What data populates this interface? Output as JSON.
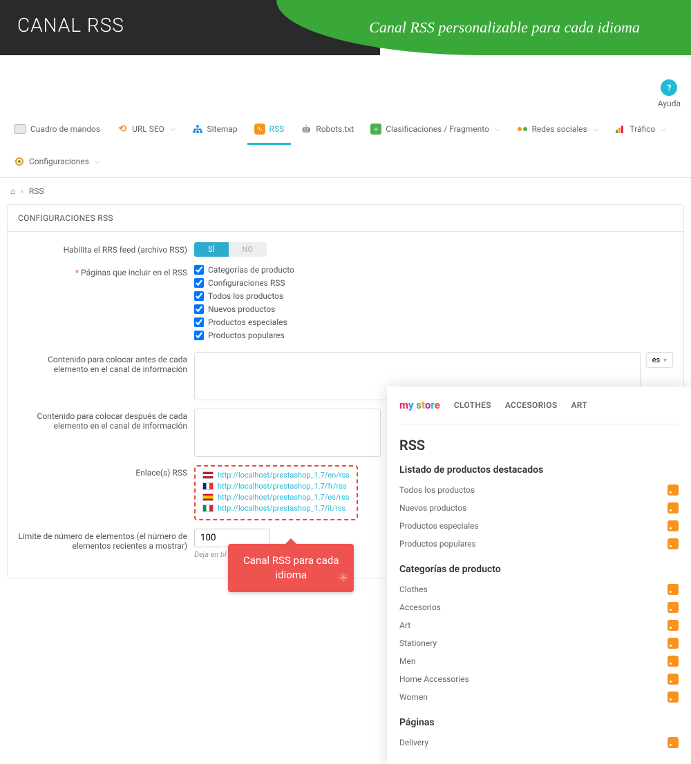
{
  "banner": {
    "title": "CANAL RSS",
    "subtitle": "Canal RSS personalizable para cada idioma"
  },
  "help": {
    "label": "Ayuda"
  },
  "tabs": {
    "dashboard": "Cuadro de mandos",
    "url": "URL SEO",
    "sitemap": "Sitemap",
    "rss": "RSS",
    "robots": "Robots.txt",
    "clasif": "Clasificaciones / Fragmento",
    "redes": "Redes sociales",
    "trafico": "Tráfico",
    "config": "Configuraciones"
  },
  "breadcrumb": {
    "current": "RSS"
  },
  "panel": {
    "header": "CONFIGURACIONES RSS",
    "enable_label": "Habilita el RRS feed (archivo RSS)",
    "toggle_yes": "SÍ",
    "toggle_no": "NO",
    "pages_label": "Páginas que incluir en el RSS",
    "checks": {
      "c1": "Categorías de producto",
      "c2": "Configuraciones RSS",
      "c3": "Todos los productos",
      "c4": "Nuevos productos",
      "c5": "Productos especiales",
      "c6": "Productos populares"
    },
    "before_label": "Contenido para colocar antes de cada elemento en el canal de información",
    "after_label": "Contenido para colocar después de cada elemento en el canal de información",
    "lang_btn": "es",
    "links_label": "Enlace(s) RSS",
    "links": {
      "en": "http://localhost/prestashop_1.7/en/rss",
      "fr": "http://localhost/prestashop_1.7/fr/rss",
      "es": "http://localhost/prestashop_1.7/es/rss",
      "it": "http://localhost/prestashop_1.7/it/rss"
    },
    "limit_label": "Límite de número de elementos (el número de elementos recientes a mostrar)",
    "limit_value": "100",
    "limit_helper": "Deja en bl"
  },
  "callout": {
    "text1": "Canal RSS para cada",
    "text2": "idioma"
  },
  "overlay": {
    "logo": "my store",
    "nav": {
      "clothes": "CLOTHES",
      "acc": "ACCESORIOS",
      "art": "ART"
    },
    "h2": "RSS",
    "sec1": "Listado de productos destacados",
    "r1": "Todos los productos",
    "r2": "Nuevos productos",
    "r3": "Productos especiales",
    "r4": "Productos populares",
    "sec2": "Categorías de producto",
    "c1": "Clothes",
    "c2": "Accesorios",
    "c3": "Art",
    "c4": "Stationery",
    "c5": "Men",
    "c6": "Home Accessories",
    "c7": "Women",
    "sec3": "Páginas",
    "p1": "Delivery"
  }
}
